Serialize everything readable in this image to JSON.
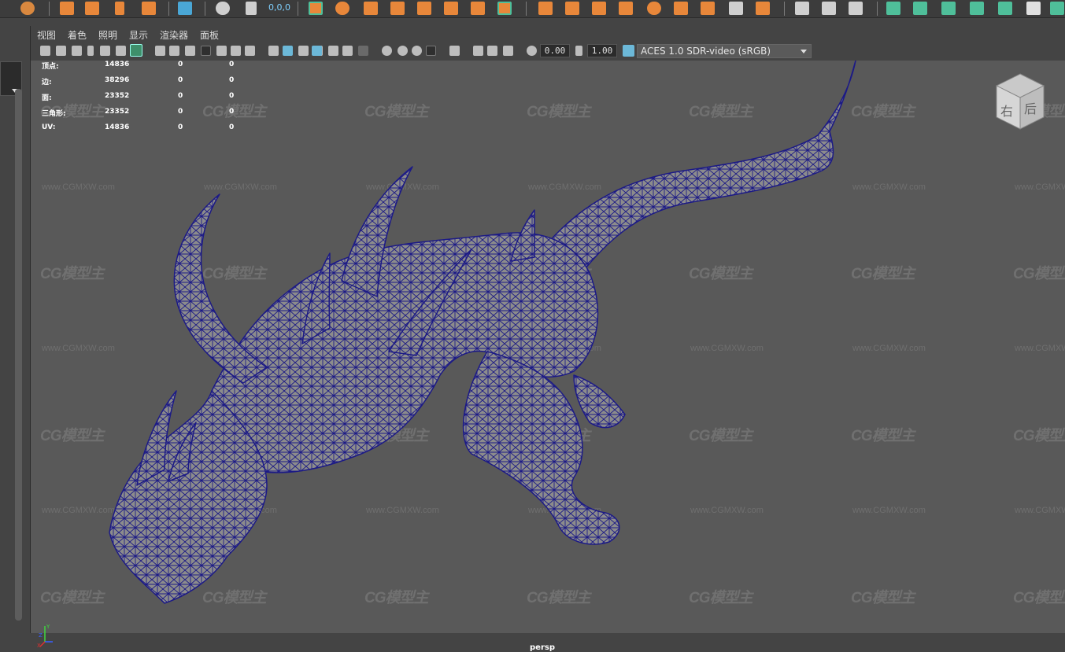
{
  "menubar": {
    "items": [
      "视图",
      "着色",
      "照明",
      "显示",
      "渲染器",
      "面板"
    ]
  },
  "shelf": {
    "coord_readout": "0,0,0",
    "accent_colors": [
      "#e8873a",
      "#4fbf9a",
      "#ffffff"
    ]
  },
  "toolbar": {
    "field_1": "0.00",
    "field_2": "1.00",
    "color_space": "ACES 1.0 SDR-video (sRGB)"
  },
  "stats": {
    "rows": [
      {
        "label": "顶点:",
        "v1": "14836",
        "v2": "0",
        "v3": "0"
      },
      {
        "label": "边:",
        "v1": "38296",
        "v2": "0",
        "v3": "0"
      },
      {
        "label": "面:",
        "v1": "23352",
        "v2": "0",
        "v3": "0"
      },
      {
        "label": "三角形:",
        "v1": "23352",
        "v2": "0",
        "v3": "0"
      },
      {
        "label": "UV:",
        "v1": "14836",
        "v2": "0",
        "v3": "0"
      }
    ]
  },
  "viewport": {
    "camera_label": "persp",
    "viewcube_labels": {
      "right": "右",
      "back": "后"
    },
    "axis_labels": {
      "y": "Y",
      "z": "Z",
      "x": "X"
    },
    "watermark": "CG模型主",
    "watermark_url": "www.CGMXW.com",
    "wire_color": "#1c1a86",
    "mesh_color": "#8c8c8c"
  }
}
